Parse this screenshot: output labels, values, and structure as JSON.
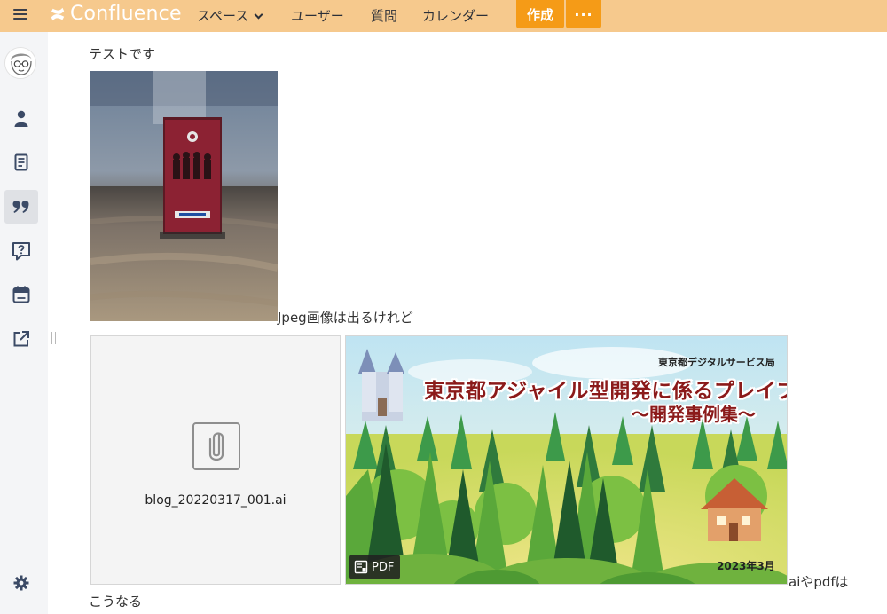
{
  "header": {
    "app_name": "Confluence",
    "nav": [
      {
        "label": "スペース",
        "has_dropdown": true
      },
      {
        "label": "ユーザー"
      },
      {
        "label": "質問"
      },
      {
        "label": "カレンダー"
      }
    ],
    "create_label": "作成",
    "more_label": "···",
    "bar_color": "#f6c98d",
    "accent_color": "#f59b17"
  },
  "sidebar": {
    "items": [
      {
        "icon": "avatar"
      },
      {
        "icon": "person-icon"
      },
      {
        "icon": "page-icon"
      },
      {
        "icon": "quote-icon",
        "active": true
      },
      {
        "icon": "question-icon"
      },
      {
        "icon": "calendar-icon"
      },
      {
        "icon": "external-link-icon"
      }
    ],
    "bottom_icon": "gear-icon"
  },
  "content": {
    "text_top": "テストです",
    "caption_jpeg": "Jpeg画像は出るけれど",
    "ai_file_name": "blog_20220317_001.ai",
    "pdf_badge": "PDF",
    "pdf_preview": {
      "org": "東京都デジタルサービス局",
      "title": "東京都アジャイル型開発に係るプレイブック",
      "subtitle": "〜開発事例集〜",
      "date": "2023年3月"
    },
    "caption_ai_pdf": "aiやpdfは",
    "text_bottom": "こうなる"
  }
}
